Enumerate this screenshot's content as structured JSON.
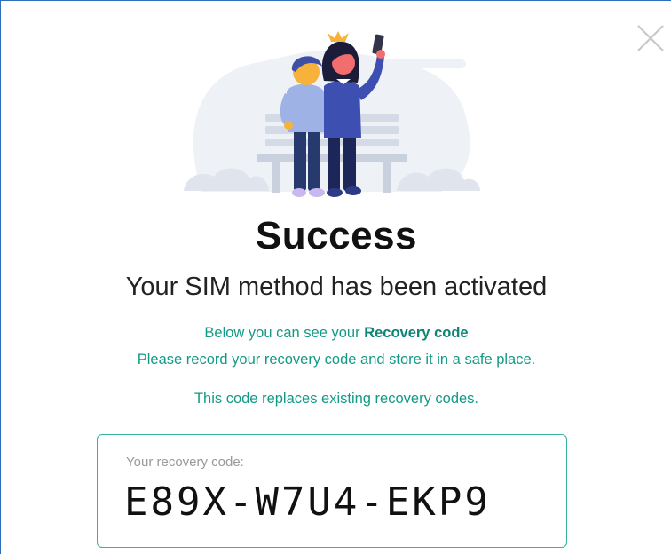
{
  "dialog": {
    "close_icon": "close-icon",
    "illustration": "couple-selfie-on-bench-illustration",
    "title": "Success",
    "subtitle": "Your SIM method has been activated",
    "info_line1_prefix": "Below you can see your ",
    "info_line1_bold": "Recovery code",
    "info_line2": "Please record your recovery code and store it in a safe place.",
    "info_line3": "This code replaces existing recovery codes.",
    "code_label": "Your recovery code:",
    "code_value": "E89X-W7U4-EKP9"
  },
  "colors": {
    "accent_teal": "#139a86",
    "box_border": "#34b3a0",
    "window_border": "#2f6fb8"
  }
}
